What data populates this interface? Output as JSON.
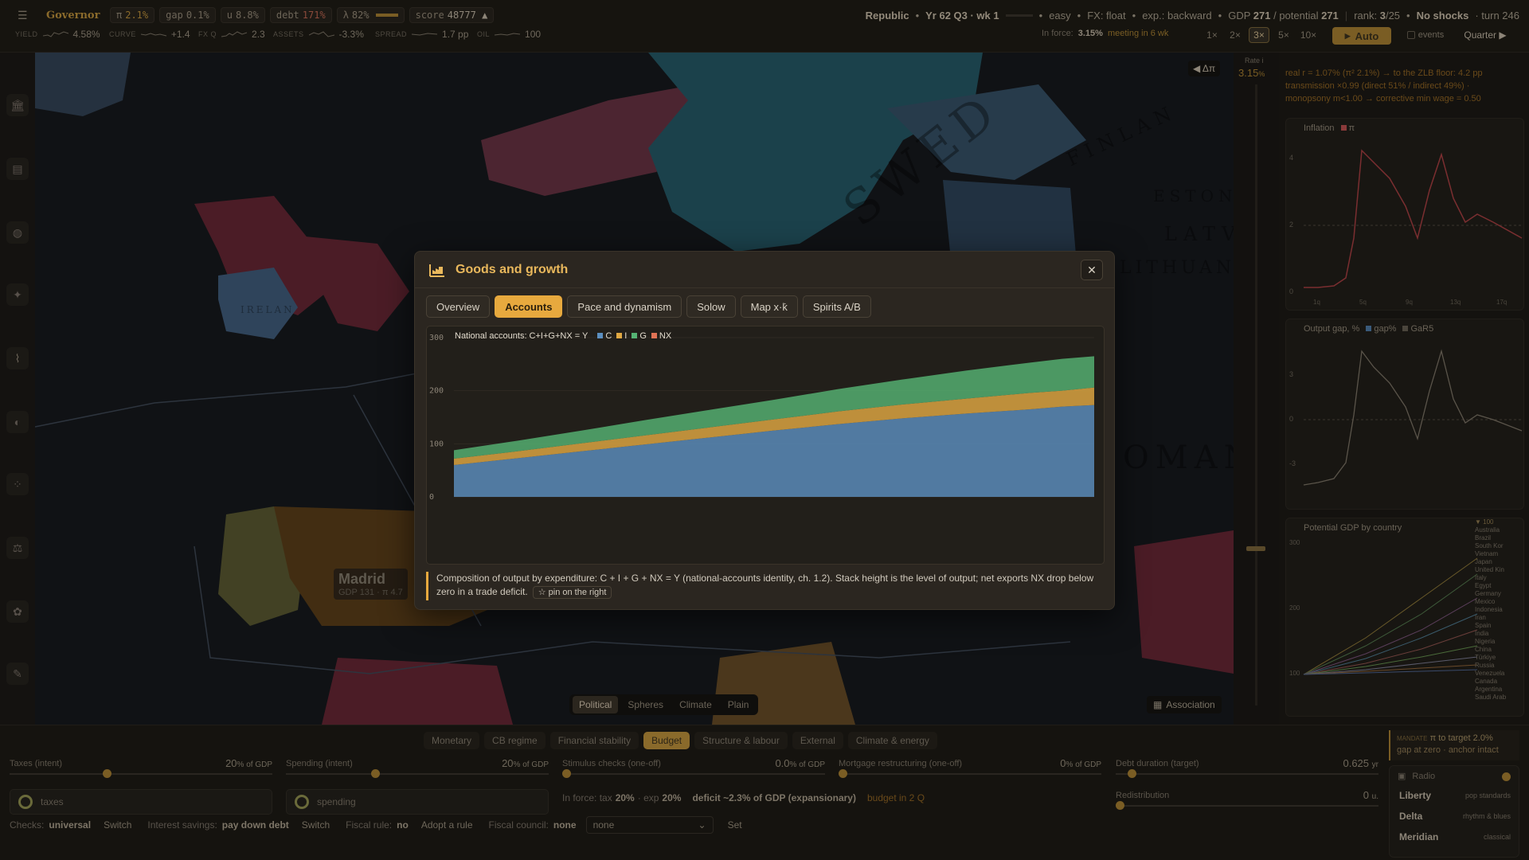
{
  "topbar": {
    "app_name": "Governor",
    "pills": [
      {
        "label": "π",
        "value": "2.1%"
      },
      {
        "label": "gap",
        "value": "0.1%"
      },
      {
        "label": "u",
        "value": "8.8%"
      },
      {
        "label": "debt",
        "value": "171%"
      },
      {
        "label": "λ",
        "value": "82%"
      },
      {
        "label": "score",
        "value": "48777 ▲"
      }
    ],
    "status": {
      "regime": "Republic",
      "period": "Yr 62 Q3 · wk 1",
      "difficulty": "easy",
      "fx": "FX: float",
      "exp": "exp.: backward",
      "gdp_label": "GDP",
      "gdp": "271",
      "potential_label": "/ potential",
      "potential": "271",
      "rank_label": "rank:",
      "rank": "3",
      "rank_total": "/25",
      "shocks": "No shocks",
      "turn": "· turn 246"
    },
    "indicators": [
      {
        "key": "YIELD",
        "value": "4.58%"
      },
      {
        "key": "CURVE",
        "value": "+1.4"
      },
      {
        "key": "FX Q",
        "value": "2.3"
      },
      {
        "key": "ASSETS",
        "value": "-3.3%"
      },
      {
        "key": "SPREAD",
        "value": "1.7 pp"
      },
      {
        "key": "OIL",
        "value": "100"
      }
    ],
    "in_force_label": "In force:",
    "in_force_rate": "3.15%",
    "meeting": "meeting in 6 wk",
    "speeds": [
      "1×",
      "2×",
      "3×",
      "5×",
      "10×"
    ],
    "active_speed": "3×",
    "auto_label": "Auto",
    "events_label": "events",
    "quarter_label": "Quarter ▶"
  },
  "map": {
    "labels": [
      "SWED",
      "IRELAN",
      "ESTONI",
      "LATVI",
      "LITHUANIA",
      "OMAN",
      "FINLAN"
    ],
    "city_name": "Madrid",
    "city_sub": "GDP 131 · π 4.7",
    "delta_btn": "◀ Δπ",
    "rate_label": "Rate i",
    "rate_value": "3.15",
    "modes": [
      "Political",
      "Spheres",
      "Climate",
      "Plain"
    ],
    "active_mode": "Political",
    "association_label": "Association"
  },
  "right_panel": {
    "info_line1": "real r = 1.07% (π² 2.1%) → to the ZLB floor: 4.2 pp",
    "info_line2": "transmission ×0.99 (direct 51% / indirect 49%) ·",
    "info_line3": "monopsony m<1.00 → corrective min wage = 0.50",
    "inflation_title": "Inflation",
    "inflation_legend": "π",
    "outputgap_title": "Output gap, %",
    "outputgap_legend1": "gap%",
    "outputgap_legend2": "GaR5",
    "potential_title": "Potential GDP by country",
    "countries": [
      "Australia",
      "Brazil",
      "South Kor",
      "Vietnam",
      "Japan",
      "United Kin",
      "Italy",
      "Egypt",
      "Germany",
      "Mexico",
      "Indonesia",
      "Iran",
      "Spain",
      "India",
      "Nigeria",
      "China",
      "Türkiye",
      "Russia",
      "Venezuela",
      "Canada",
      "Argentina",
      "Saudi Arab"
    ],
    "countries_more": "▼ 100",
    "inflation_ticks": [
      "4",
      "2",
      "0"
    ],
    "gap_ticks": [
      "3",
      "0",
      "-3"
    ],
    "potential_ticks": [
      "300",
      "200",
      "100"
    ],
    "x_ticks": [
      "1q",
      "5q",
      "9q",
      "13q",
      "17q"
    ]
  },
  "bottom": {
    "tabs": [
      "Monetary",
      "CB regime",
      "Financial stability",
      "Budget",
      "Structure & labour",
      "External",
      "Climate & energy"
    ],
    "active_tab": "Budget",
    "sliders": [
      {
        "label": "Taxes (intent)",
        "value": "20",
        "unit": "% of GDP",
        "fraction": 0.36
      },
      {
        "label": "Spending (intent)",
        "value": "20",
        "unit": "% of GDP",
        "fraction": 0.36
      },
      {
        "label": "Stimulus checks (one-off)",
        "value": "0.0",
        "unit": "% of GDP",
        "fraction": 0.02
      },
      {
        "label": "Mortgage restructuring (one-off)",
        "value": "0",
        "unit": "% of GDP",
        "fraction": 0.02
      },
      {
        "label": "Debt duration (target)",
        "value": "0.625",
        "unit": "yr",
        "fraction": 0.12
      }
    ],
    "redistribution_label": "Redistribution",
    "redistribution_value": "0",
    "redistribution_unit": "u.",
    "taxes_toggle": "taxes",
    "spending_toggle": "spending",
    "in_force_tax": "In force: tax",
    "tax_val": "20%",
    "exp_label": "· exp",
    "exp_val": "20%",
    "deficit_text": "deficit ~2.3% of GDP (expansionary)",
    "budget_in": "budget in 2 Q",
    "checks_label": "Checks:",
    "checks_value": "universal",
    "switch_label": "Switch",
    "interest_label": "Interest savings:",
    "interest_value": "pay down debt",
    "fiscal_rule_label": "Fiscal rule:",
    "fiscal_rule_value": "no",
    "adopt_rule": "Adopt a rule",
    "council_label": "Fiscal council:",
    "council_value": "none",
    "council_select": "none",
    "set_label": "Set",
    "mandate_label": "MANDATE",
    "mandate_text": "π to target 2.0%",
    "mandate_sub": "gap at zero · anchor intact",
    "radio_label": "Radio",
    "stations": [
      {
        "name": "Liberty",
        "genre": "pop standards"
      },
      {
        "name": "Delta",
        "genre": "rhythm & blues"
      },
      {
        "name": "Meridian",
        "genre": "classical"
      }
    ]
  },
  "modal": {
    "title": "Goods and growth",
    "tabs": [
      "Overview",
      "Accounts",
      "Pace and dynamism",
      "Solow",
      "Map x·k̇",
      "Spirits A/B"
    ],
    "active_tab": "Accounts",
    "chart_legend_title": "National accounts: C+I+G+NX = Y",
    "note": "Composition of output by expenditure: C + I + G + NX = Y (national-accounts identity, ch. 1.2). Stack height is the level of output; net exports NX drop below zero in a trade deficit.",
    "pin_label": "☆ pin on the right",
    "close_label": "✕"
  },
  "chart_data": {
    "type": "area",
    "title": "National accounts: C+I+G+NX = Y",
    "stacked": true,
    "y_ticks": [
      0,
      100,
      200,
      300
    ],
    "ylim": [
      0,
      300
    ],
    "x": [
      0,
      10,
      20,
      30,
      40,
      50,
      60,
      70,
      80,
      90,
      95,
      100
    ],
    "series": [
      {
        "name": "C",
        "color": "#5b8fc0",
        "values": [
          60,
          73,
          86,
          99,
          112,
          125,
          137,
          148,
          157,
          165,
          170,
          173
        ]
      },
      {
        "name": "I",
        "color": "#e0a843",
        "values": [
          12,
          13,
          15,
          17,
          19,
          21,
          24,
          26,
          28,
          31,
          30,
          33
        ]
      },
      {
        "name": "G",
        "color": "#55b374",
        "values": [
          16,
          20,
          24,
          29,
          33,
          37,
          42,
          47,
          53,
          57,
          60,
          59
        ]
      },
      {
        "name": "NX",
        "color": "#e07355",
        "values": [
          0,
          0,
          0,
          0,
          0,
          0,
          0,
          0,
          0,
          0,
          0,
          0
        ]
      }
    ]
  }
}
